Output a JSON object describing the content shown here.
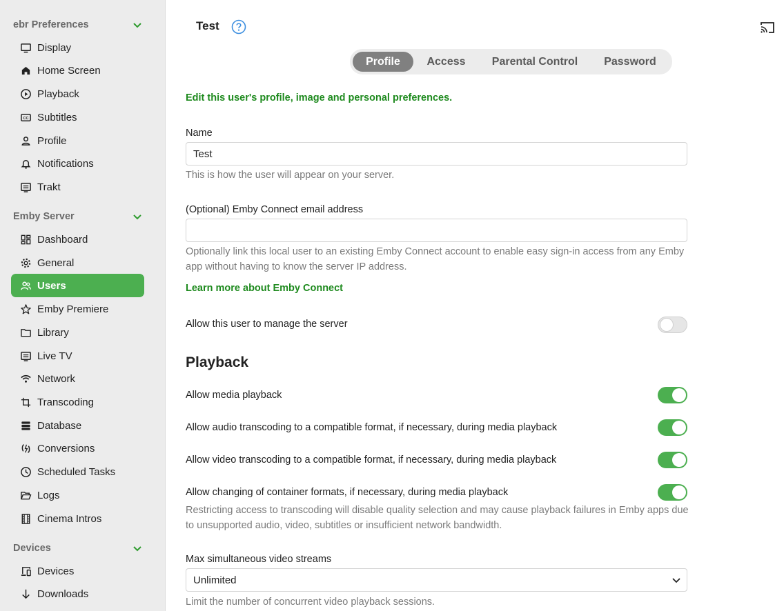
{
  "sidebar": {
    "sections": [
      {
        "title": "ebr Preferences"
      },
      {
        "title": "Emby Server"
      },
      {
        "title": "Devices"
      }
    ],
    "items": [
      {
        "label": "Display",
        "icon": "monitor-icon"
      },
      {
        "label": "Home Screen",
        "icon": "home-icon"
      },
      {
        "label": "Playback",
        "icon": "play-circle-icon"
      },
      {
        "label": "Subtitles",
        "icon": "closed-captions-icon"
      },
      {
        "label": "Profile",
        "icon": "person-icon"
      },
      {
        "label": "Notifications",
        "icon": "bell-icon"
      },
      {
        "label": "Trakt",
        "icon": "list-box-icon"
      },
      {
        "label": "Dashboard",
        "icon": "dashboard-icon"
      },
      {
        "label": "General",
        "icon": "gear-icon"
      },
      {
        "label": "Users",
        "icon": "users-icon"
      },
      {
        "label": "Emby Premiere",
        "icon": "star-icon"
      },
      {
        "label": "Library",
        "icon": "folder-icon"
      },
      {
        "label": "Live TV",
        "icon": "tv-guide-icon"
      },
      {
        "label": "Network",
        "icon": "wifi-icon"
      },
      {
        "label": "Transcoding",
        "icon": "transcode-icon"
      },
      {
        "label": "Database",
        "icon": "database-icon"
      },
      {
        "label": "Conversions",
        "icon": "convert-icon"
      },
      {
        "label": "Scheduled Tasks",
        "icon": "clock-icon"
      },
      {
        "label": "Logs",
        "icon": "folder-open-icon"
      },
      {
        "label": "Cinema Intros",
        "icon": "film-icon"
      },
      {
        "label": "Devices",
        "icon": "devices-icon"
      },
      {
        "label": "Downloads",
        "icon": "download-arrow-icon"
      }
    ],
    "active_item": "Users"
  },
  "header": {
    "title": "Test",
    "help_icon": "help-circle-icon",
    "cast_icon": "cast-icon"
  },
  "tabs": [
    {
      "label": "Profile",
      "active": true
    },
    {
      "label": "Access",
      "active": false
    },
    {
      "label": "Parental Control",
      "active": false
    },
    {
      "label": "Password",
      "active": false
    }
  ],
  "form": {
    "intro": "Edit this user's profile, image and personal preferences.",
    "name_label": "Name",
    "name_value": "Test",
    "name_help": "This is how the user will appear on your server.",
    "connect_label": "(Optional) Emby Connect email address",
    "connect_value": "",
    "connect_help": "Optionally link this local user to an existing Emby Connect account to enable easy sign-in access from any Emby app without having to know the server IP address.",
    "connect_link": "Learn more about Emby Connect",
    "manage_server_label": "Allow this user to manage the server",
    "manage_server_on": false
  },
  "playback": {
    "heading": "Playback",
    "toggles": [
      {
        "label": "Allow media playback",
        "on": true
      },
      {
        "label": "Allow audio transcoding to a compatible format, if necessary, during media playback",
        "on": true
      },
      {
        "label": "Allow video transcoding to a compatible format, if necessary, during media playback",
        "on": true
      },
      {
        "label": "Allow changing of container formats, if necessary, during media playback",
        "on": true
      }
    ],
    "transcode_help": "Restricting access to transcoding will disable quality selection and may cause playback failures in Emby apps due to unsupported audio, video, subtitles or insufficient network bandwidth.",
    "streams_label": "Max simultaneous video streams",
    "streams_value": "Unlimited",
    "streams_help": "Limit the number of concurrent video playback sessions."
  },
  "colors": {
    "accent": "#4caf50",
    "link_green": "#1e8a1e",
    "help_blue": "#3d8fe0"
  }
}
